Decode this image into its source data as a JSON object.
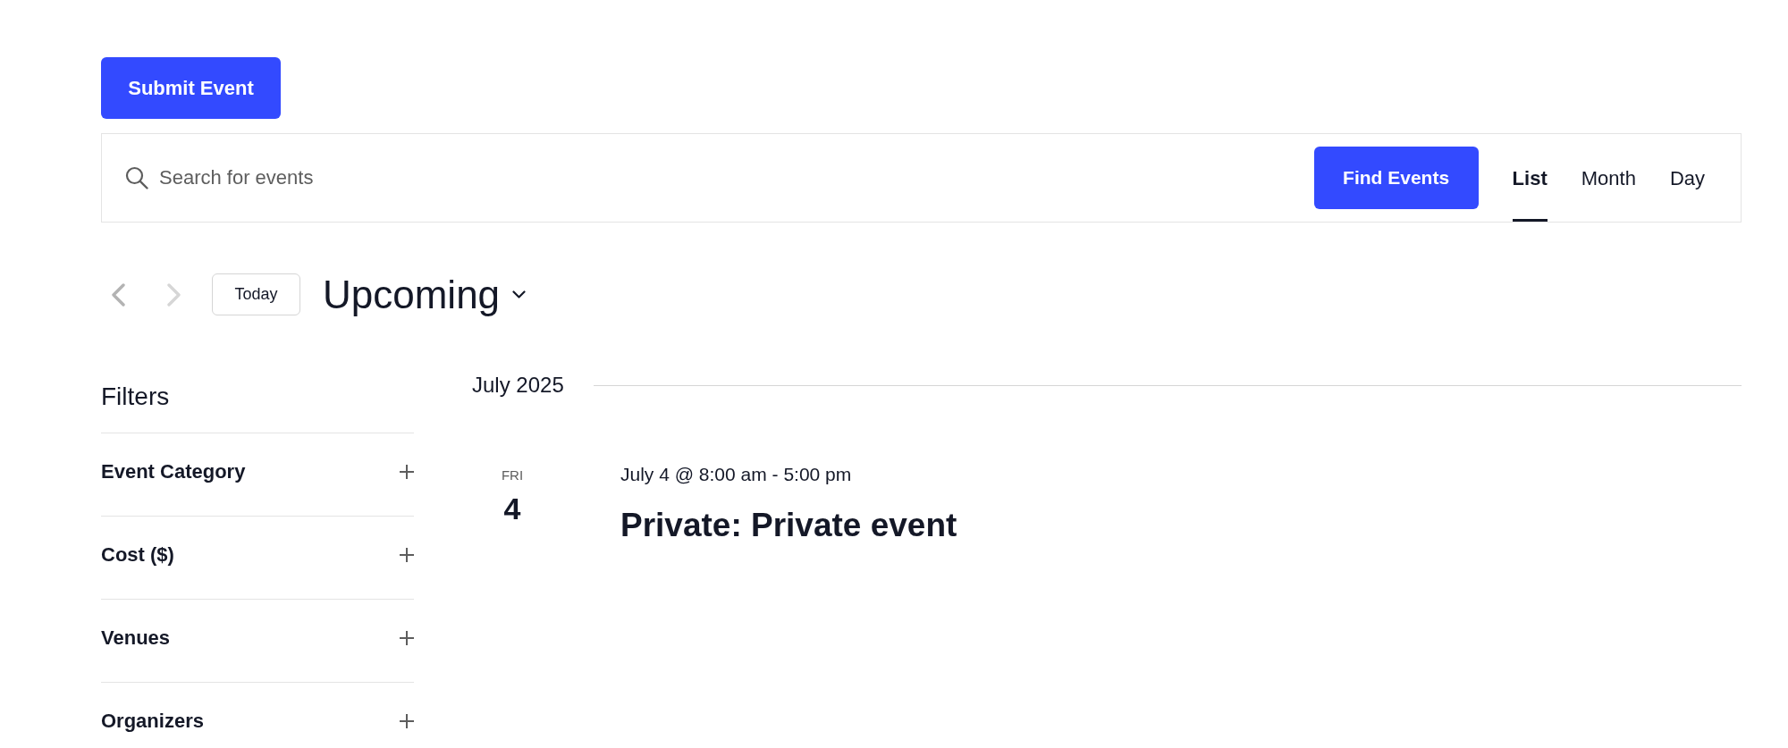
{
  "submit_button": {
    "label": "Submit Event"
  },
  "search_bar": {
    "placeholder": "Search for events",
    "button": "Find Events",
    "views": [
      {
        "label": "List",
        "selected": true
      },
      {
        "label": "Month",
        "selected": false
      },
      {
        "label": "Day",
        "selected": false
      }
    ]
  },
  "nav": {
    "prev": {
      "disabled": false
    },
    "next": {
      "disabled": true
    },
    "today": "Today",
    "range": "Upcoming"
  },
  "filters": {
    "title": "Filters",
    "items": [
      {
        "label": "Event Category",
        "expanded": false
      },
      {
        "label": "Cost ($)",
        "expanded": false
      },
      {
        "label": "Venues",
        "expanded": false
      },
      {
        "label": "Organizers",
        "expanded": false
      }
    ]
  },
  "events": {
    "month": "July 2025",
    "items": [
      {
        "weekday": "FRI",
        "day": "4",
        "time": "July 4 @ 8:00 am - 5:00 pm",
        "title": "Private: Private event"
      }
    ]
  }
}
